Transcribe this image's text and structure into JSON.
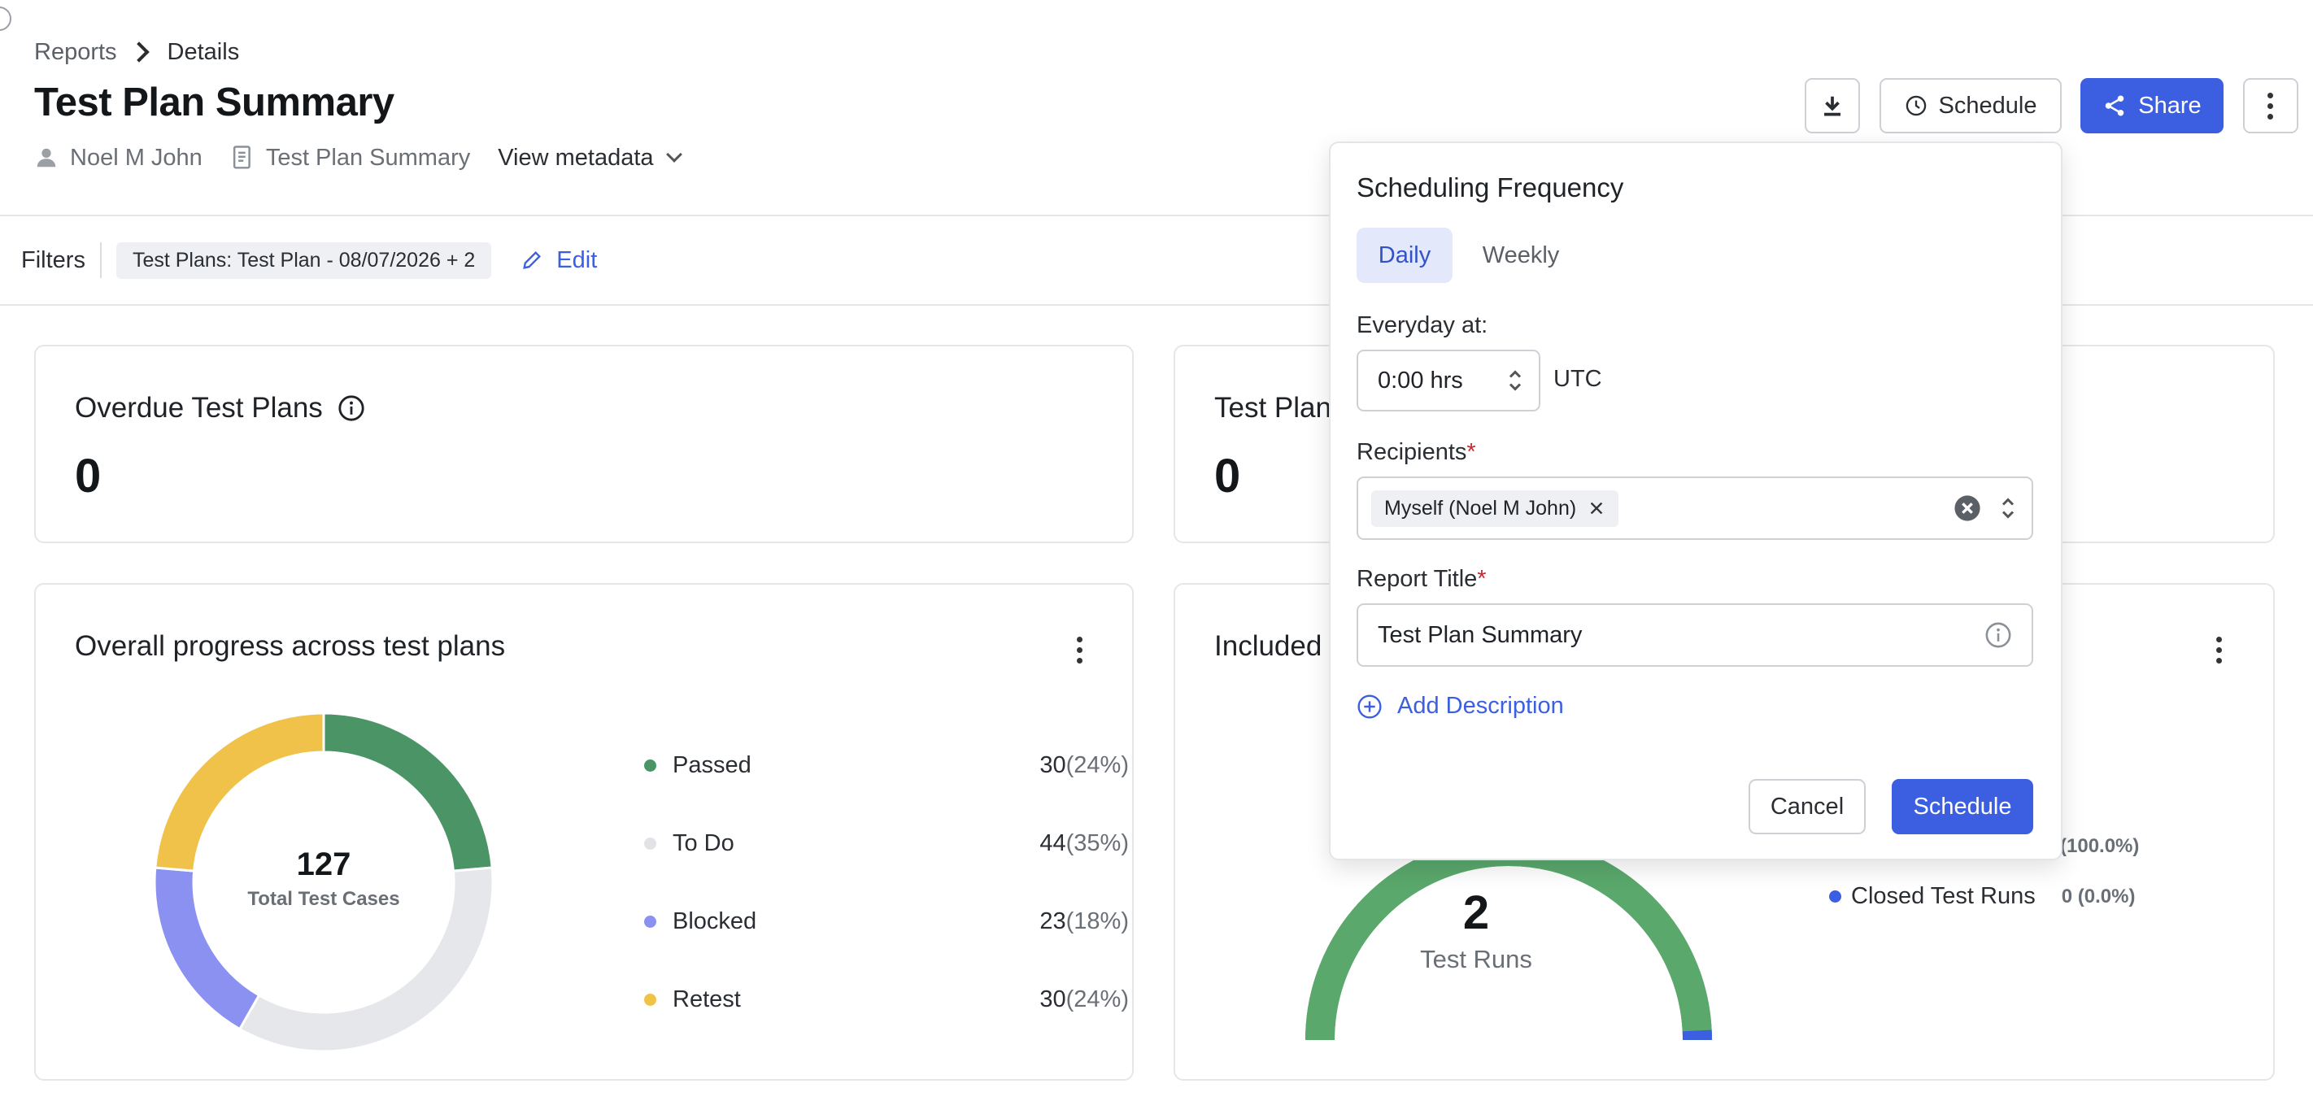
{
  "breadcrumb": {
    "parent": "Reports",
    "current": "Details"
  },
  "page": {
    "title": "Test Plan Summary"
  },
  "meta": {
    "author": "Noel M John",
    "report": "Test Plan Summary",
    "view_metadata": "View metadata"
  },
  "toolbar": {
    "schedule_label": "Schedule",
    "share_label": "Share"
  },
  "filters": {
    "label": "Filters",
    "chip": "Test Plans: Test Plan - 08/07/2026 + 2",
    "edit_label": "Edit"
  },
  "cards": {
    "overdue": {
      "title": "Overdue Test Plans",
      "value": "0"
    },
    "second": {
      "title_visible": "Test Plan",
      "value": "0"
    },
    "progress": {
      "title": "Overall progress across test plans"
    },
    "included": {
      "title_visible": "Included"
    }
  },
  "donut": {
    "total": "127",
    "total_label": "Total Test Cases",
    "legend": [
      {
        "label": "Passed",
        "count": "30",
        "pct": "(24%)",
        "color": "#4a9466"
      },
      {
        "label": "To Do",
        "count": "44",
        "pct": "(35%)",
        "color": "#e6e7ea"
      },
      {
        "label": "Blocked",
        "count": "23",
        "pct": "(18%)",
        "color": "#8b91f0"
      },
      {
        "label": "Retest",
        "count": "30",
        "pct": "(24%)",
        "color": "#f0c24a"
      }
    ]
  },
  "gauge": {
    "value": "2",
    "label": "Test Runs",
    "legend_open_pct": "(100.0%)",
    "legend_closed_label": "Closed Test Runs",
    "legend_closed_value": "0 (0.0%)",
    "open_fraction": 1.0,
    "open_color": "#5aa86c",
    "closed_color": "#3b5fe0"
  },
  "schedule_popover": {
    "title": "Scheduling Frequency",
    "tabs": [
      "Daily",
      "Weekly"
    ],
    "active_tab": "Daily",
    "everyday_label": "Everyday at:",
    "time_value": "0:00 hrs",
    "timezone": "UTC",
    "recipients_label": "Recipients",
    "recipient_tag": "Myself (Noel M John)",
    "report_title_label": "Report Title",
    "report_title_value": "Test Plan Summary",
    "add_description": "Add Description",
    "cancel_label": "Cancel",
    "schedule_label": "Schedule"
  },
  "colors": {
    "accent": "#3b5fe0",
    "required": "#d1242f"
  }
}
